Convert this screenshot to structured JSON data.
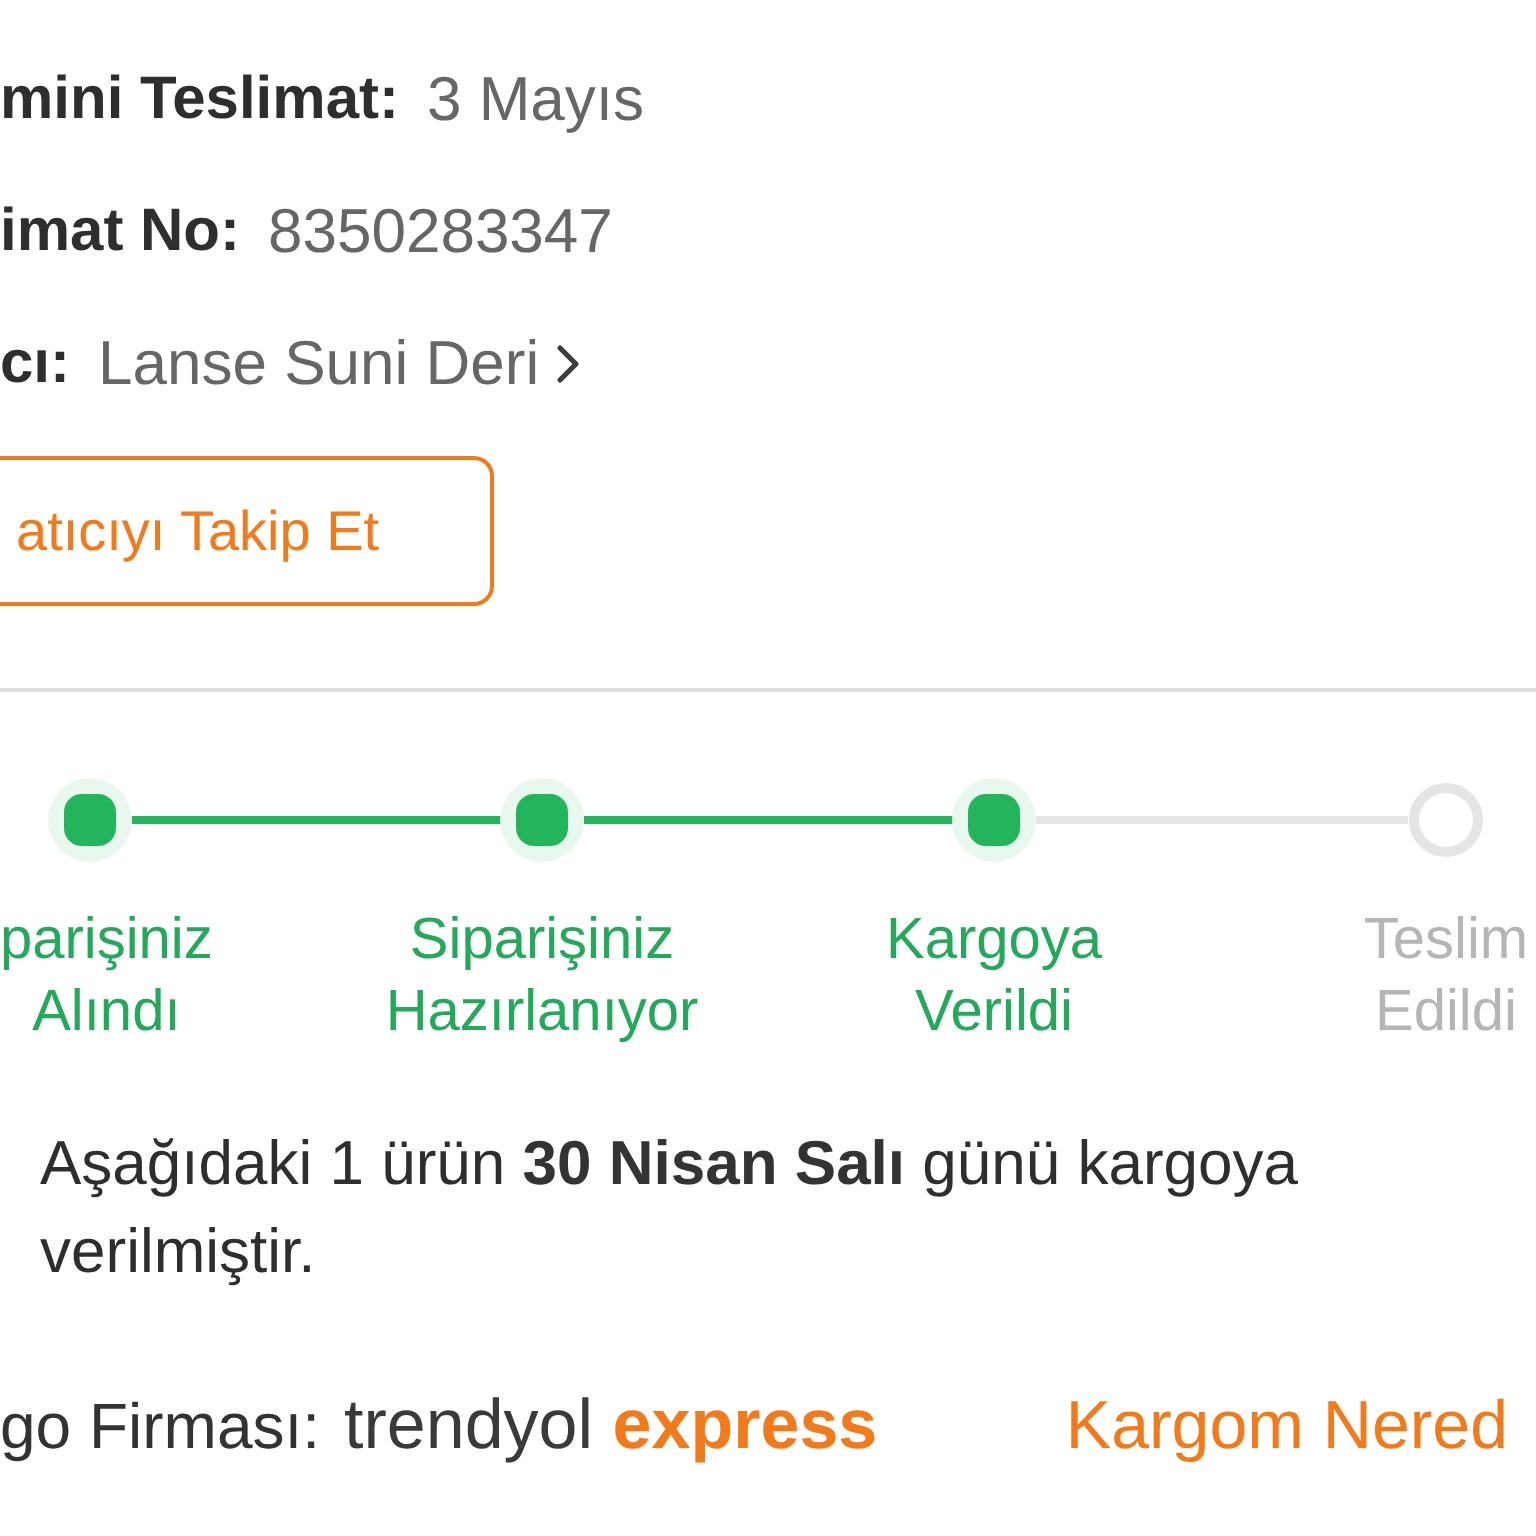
{
  "details": [
    {
      "label": "mini Teslimat:",
      "value": "3 Mayıs",
      "kind": "text"
    },
    {
      "label": "imat No:",
      "value": "8350283347",
      "kind": "text"
    },
    {
      "label": "cı:",
      "value": "Lanse Suni Deri",
      "kind": "link"
    }
  ],
  "follow_button": {
    "label": "atıcıyı Takip Et"
  },
  "steps": [
    {
      "label": "parişiniz\nAlındı",
      "done": true
    },
    {
      "label": "Siparişiniz\nHazırlanıyor",
      "done": true
    },
    {
      "label": "Kargoya\nVerildi",
      "done": true
    },
    {
      "label": "Teslim\nEdildi",
      "done": false
    }
  ],
  "shipment_note": "Aşağıdaki 1 ürün **30 Nisan Salı** günü kargoya verilmiştir.",
  "carrier": {
    "label": "go Firması:",
    "logo": [
      "trendyol",
      "express"
    ]
  },
  "track_link": "Kargom Nered"
}
